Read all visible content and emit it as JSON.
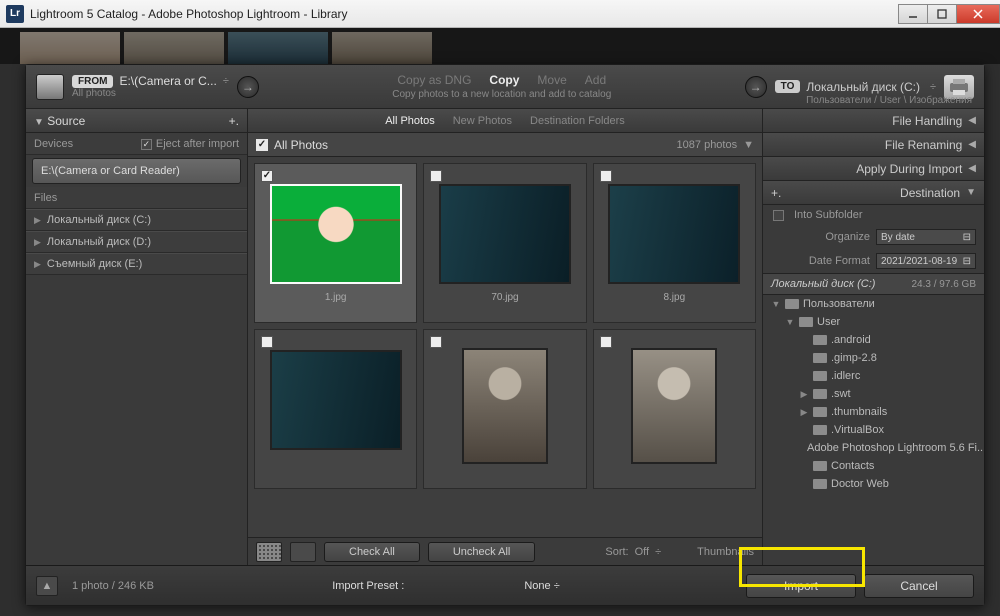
{
  "window": {
    "title": "Lightroom 5 Catalog - Adobe Photoshop Lightroom - Library",
    "lr": "Lr"
  },
  "header": {
    "from_pill": "FROM",
    "to_pill": "TO",
    "source_name": "E:\\(Camera or C...",
    "source_sub": "All photos",
    "dest_name": "Локальный диск (C:)",
    "dest_path": "Пользователи / User \\ Изображения",
    "ops": {
      "copy_dng": "Copy as DNG",
      "copy": "Copy",
      "move": "Move",
      "add": "Add"
    },
    "sub": "Copy photos to a new location and add to catalog"
  },
  "left": {
    "panel": "Source",
    "devices": "Devices",
    "eject": "Eject after import",
    "device_item": "E:\\(Camera or Card Reader)",
    "files": "Files",
    "disks": [
      "Локальный диск (C:)",
      "Локальный диск (D:)",
      "Съемный диск (E:)"
    ]
  },
  "mid": {
    "tabs": {
      "all": "All Photos",
      "new": "New Photos",
      "dest": "Destination Folders"
    },
    "allbar": {
      "label": "All Photos",
      "count": "1087 photos"
    },
    "thumbs": [
      {
        "cap": "1.jpg",
        "cls": "a",
        "sel": true
      },
      {
        "cap": "70.jpg",
        "cls": "b",
        "sel": false
      },
      {
        "cap": "8.jpg",
        "cls": "c",
        "sel": false
      },
      {
        "cap": "",
        "cls": "d",
        "sel": false
      },
      {
        "cap": "",
        "cls": "e",
        "sel": false
      },
      {
        "cap": "",
        "cls": "f",
        "sel": false
      }
    ],
    "buttons": {
      "check_all": "Check All",
      "uncheck_all": "Uncheck All"
    },
    "sort": {
      "label": "Sort:",
      "value": "Off"
    },
    "thumbs_label": "Thumbnails"
  },
  "right": {
    "panels": {
      "file_handling": "File Handling",
      "file_renaming": "File Renaming",
      "apply": "Apply During Import",
      "destination": "Destination"
    },
    "into_sub": "Into Subfolder",
    "organize": {
      "label": "Organize",
      "value": "By date"
    },
    "date_format": {
      "label": "Date Format",
      "value": "2021/2021-08-19"
    },
    "disk": {
      "name": "Локальный диск (C:)",
      "space": "24.3 / 97.6 GB"
    },
    "tree": [
      {
        "indent": 0,
        "expand": "▼",
        "label": "Пользователи"
      },
      {
        "indent": 1,
        "expand": "▼",
        "label": "User"
      },
      {
        "indent": 2,
        "expand": "",
        "label": ".android"
      },
      {
        "indent": 2,
        "expand": "",
        "label": ".gimp-2.8"
      },
      {
        "indent": 2,
        "expand": "",
        "label": ".idlerc"
      },
      {
        "indent": 2,
        "expand": "▶",
        "label": ".swt"
      },
      {
        "indent": 2,
        "expand": "▶",
        "label": ".thumbnails"
      },
      {
        "indent": 2,
        "expand": "",
        "label": ".VirtualBox"
      },
      {
        "indent": 2,
        "expand": "",
        "label": "Adobe Photoshop Lightroom 5.6 Fi..."
      },
      {
        "indent": 2,
        "expand": "",
        "label": "Contacts"
      },
      {
        "indent": 2,
        "expand": "",
        "label": "Doctor Web"
      }
    ]
  },
  "footer": {
    "info": "1 photo / 246 KB",
    "preset_label": "Import Preset :",
    "preset_value": "None ÷",
    "import": "Import",
    "cancel": "Cancel"
  }
}
